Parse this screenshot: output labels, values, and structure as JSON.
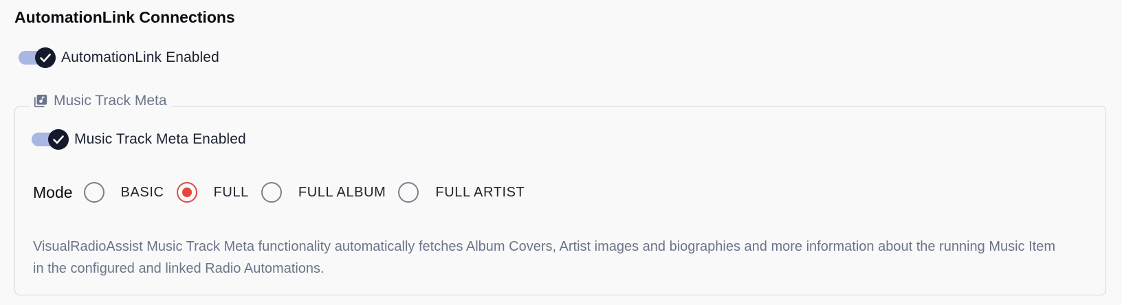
{
  "section": {
    "title": "AutomationLink Connections"
  },
  "automation_link": {
    "label": "AutomationLink Enabled",
    "enabled": true
  },
  "music_track_meta": {
    "legend": "Music Track Meta",
    "legend_icon": "music-library-icon",
    "enabled_label": "Music Track Meta Enabled",
    "enabled": true,
    "mode": {
      "label": "Mode",
      "selected": "FULL",
      "options": [
        {
          "label": "BASIC",
          "checked": false
        },
        {
          "label": "FULL",
          "checked": true
        },
        {
          "label": "FULL ALBUM",
          "checked": false
        },
        {
          "label": "FULL ARTIST",
          "checked": false
        }
      ]
    },
    "description": "VisualRadioAssist Music Track Meta functionality automatically fetches Album Covers, Artist images and biographies and more information about the running Music Item in the configured and linked Radio Automations."
  },
  "colors": {
    "toggle_track": "#a9b5e3",
    "toggle_thumb": "#141a2c",
    "radio_accent": "#e4463f",
    "muted_text": "#6b7589"
  }
}
